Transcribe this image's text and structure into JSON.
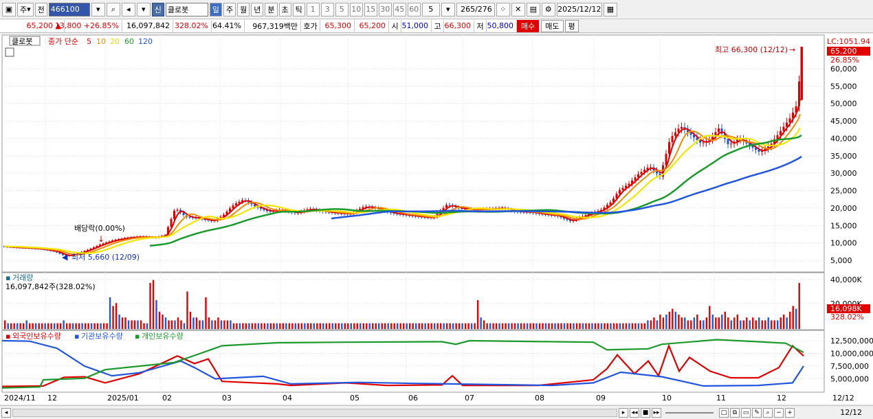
{
  "toolbar": {
    "period_label": "주",
    "prev_label": "전",
    "code": "466100",
    "badge": "신",
    "stock_name": "클로봇",
    "intervals": [
      "일",
      "주",
      "월",
      "년",
      "분",
      "초",
      "틱"
    ],
    "active_interval": "일",
    "numbers": [
      "1",
      "3",
      "5",
      "10",
      "15",
      "30",
      "45",
      "60"
    ],
    "count_value": "5",
    "page_counter": "265",
    "page_total": "/276",
    "date": "2025/12/12"
  },
  "info": {
    "price": "65,200",
    "change": "13,800",
    "change_pct": "+26.85%",
    "volume": "16,097,842",
    "vol_ratio": "328.02%",
    "turnover": "64.41%",
    "amount": "967,319백만",
    "quote_label": "호가",
    "ask": "65,300",
    "bid": "65,200",
    "open_label": "시",
    "open": "51,000",
    "high_label": "고",
    "high": "66,300",
    "low_label": "저",
    "low": "50,800",
    "buy": "매수",
    "sell": "매도",
    "eval": "평"
  },
  "chart_labels": {
    "name_tag": "클로봇",
    "legend_prefix": "종가 단순",
    "ma_periods": [
      "5",
      "10",
      "20",
      "60",
      "120"
    ],
    "ma_colors": [
      "#e00000",
      "#f08a00",
      "#f2e600",
      "#1a9a2a",
      "#2255dd"
    ],
    "lc_label": "LC:1051.94",
    "price_tag": "65,200",
    "pct_tag": "26.85%",
    "high_annot": "최고 66,300 (12/12)",
    "low_annot": "최저 5,660 (12/09)",
    "div_annot": "배당락(0.00%)",
    "vol_title": "거래량",
    "vol_value": "16,097,842주(328.02%)",
    "vol_tag": "16,098K",
    "vol_pct_tag": "328.02%",
    "holdings_title_1": "외국인보유수량",
    "holdings_title_2": "기관보유수량",
    "holdings_title_3": "개인보유수량",
    "date_right": "12/12"
  },
  "chart_data": {
    "type": "line",
    "price_axis": [
      "60,000",
      "55,000",
      "50,000",
      "45,000",
      "40,000",
      "35,000",
      "30,000",
      "25,000",
      "20,000",
      "15,000",
      "10,000",
      "5,000"
    ],
    "volume_axis": [
      "40,000K",
      "20,000K"
    ],
    "holdings_axis": [
      "12,500,000",
      "10,000,000",
      "7,500,000",
      "5,000,000"
    ],
    "months": [
      "2024/11",
      "12",
      "2025/01",
      "02",
      "03",
      "04",
      "05",
      "06",
      "07",
      "08",
      "09",
      "10",
      "11",
      "12"
    ],
    "ylim": [
      0,
      66300
    ],
    "close_points": [
      [
        0,
        9000
      ],
      [
        20,
        8700
      ],
      [
        40,
        8500
      ],
      [
        60,
        8200
      ],
      [
        80,
        7500
      ],
      [
        95,
        6200
      ],
      [
        110,
        6800
      ],
      [
        130,
        8200
      ],
      [
        145,
        9500
      ],
      [
        165,
        10800
      ],
      [
        185,
        11500
      ],
      [
        205,
        11800
      ],
      [
        225,
        11500
      ],
      [
        240,
        12200
      ],
      [
        255,
        20000
      ],
      [
        270,
        17500
      ],
      [
        290,
        17000
      ],
      [
        310,
        16200
      ],
      [
        325,
        18000
      ],
      [
        340,
        21000
      ],
      [
        355,
        22500
      ],
      [
        370,
        20500
      ],
      [
        390,
        19000
      ],
      [
        410,
        19500
      ],
      [
        430,
        18500
      ],
      [
        450,
        19800
      ],
      [
        470,
        19000
      ],
      [
        490,
        18500
      ],
      [
        510,
        18300
      ],
      [
        530,
        20500
      ],
      [
        550,
        19800
      ],
      [
        570,
        18500
      ],
      [
        590,
        18000
      ],
      [
        610,
        17500
      ],
      [
        630,
        17200
      ],
      [
        650,
        21000
      ],
      [
        670,
        19800
      ],
      [
        690,
        19500
      ],
      [
        710,
        19700
      ],
      [
        730,
        20000
      ],
      [
        750,
        19000
      ],
      [
        770,
        18800
      ],
      [
        790,
        18200
      ],
      [
        810,
        17800
      ],
      [
        830,
        16200
      ],
      [
        845,
        17500
      ],
      [
        860,
        18500
      ],
      [
        875,
        19500
      ],
      [
        890,
        22000
      ],
      [
        900,
        25000
      ],
      [
        915,
        27000
      ],
      [
        930,
        30000
      ],
      [
        945,
        32000
      ],
      [
        960,
        29000
      ],
      [
        975,
        40000
      ],
      [
        990,
        43500
      ],
      [
        1005,
        41000
      ],
      [
        1020,
        38500
      ],
      [
        1035,
        40000
      ],
      [
        1045,
        43000
      ],
      [
        1060,
        38000
      ],
      [
        1075,
        40000
      ],
      [
        1090,
        38000
      ],
      [
        1105,
        36000
      ],
      [
        1120,
        38000
      ],
      [
        1135,
        42000
      ],
      [
        1150,
        46000
      ],
      [
        1160,
        50000
      ],
      [
        1166,
        65200
      ]
    ],
    "volume_values": [
      3,
      2,
      2,
      2,
      2,
      2,
      2,
      3,
      2,
      2,
      2,
      2,
      2,
      2,
      2,
      2,
      2,
      2,
      2,
      3,
      2,
      2,
      2,
      2,
      2,
      2,
      2,
      2,
      2,
      2,
      2,
      2,
      2,
      2,
      11,
      8,
      9,
      5,
      4,
      4,
      3,
      3,
      3,
      3,
      3,
      2,
      2,
      16,
      17,
      10,
      6,
      5,
      4,
      3,
      3,
      3,
      4,
      3,
      2,
      13,
      6,
      4,
      4,
      3,
      3,
      11,
      4,
      3,
      3,
      4,
      3,
      3,
      3,
      3,
      2,
      2,
      2,
      2,
      2,
      2,
      2,
      2,
      2,
      2,
      2,
      2,
      2,
      2,
      2,
      2,
      2,
      2,
      2,
      2,
      2,
      2,
      2,
      2,
      2,
      2,
      2,
      2,
      2,
      2,
      2,
      2,
      2,
      2,
      2,
      2,
      2,
      2,
      2,
      2,
      2,
      2,
      2,
      2,
      2,
      2,
      2,
      2,
      2,
      2,
      2,
      2,
      2,
      2,
      2,
      2,
      2,
      2,
      2,
      2,
      2,
      2,
      2,
      2,
      2,
      2,
      2,
      2,
      2,
      2,
      2,
      2,
      2,
      2,
      2,
      2,
      2,
      2,
      2,
      10,
      4,
      3,
      2,
      2,
      2,
      2,
      2,
      2,
      2,
      2,
      2,
      2,
      2,
      2,
      2,
      2,
      2,
      2,
      2,
      2,
      2,
      2,
      2,
      2,
      2,
      2,
      2,
      2,
      2,
      2,
      2,
      2,
      2,
      2,
      2,
      2,
      2,
      2,
      2,
      2,
      2,
      2,
      2,
      2,
      2,
      2,
      2,
      2,
      2,
      2,
      2,
      2,
      2,
      2,
      3,
      3,
      4,
      3,
      5,
      4,
      5,
      6,
      7,
      6,
      5,
      4,
      4,
      3,
      3,
      4,
      5,
      3,
      3,
      4,
      8,
      5,
      4,
      4,
      5,
      6,
      4,
      3,
      4,
      5,
      3,
      3,
      4,
      3,
      4,
      3,
      4,
      3,
      3,
      4,
      3,
      3,
      3,
      4,
      5,
      4,
      6,
      8,
      7,
      16
    ]
  },
  "bottom": {
    "date_right": "12/12"
  }
}
